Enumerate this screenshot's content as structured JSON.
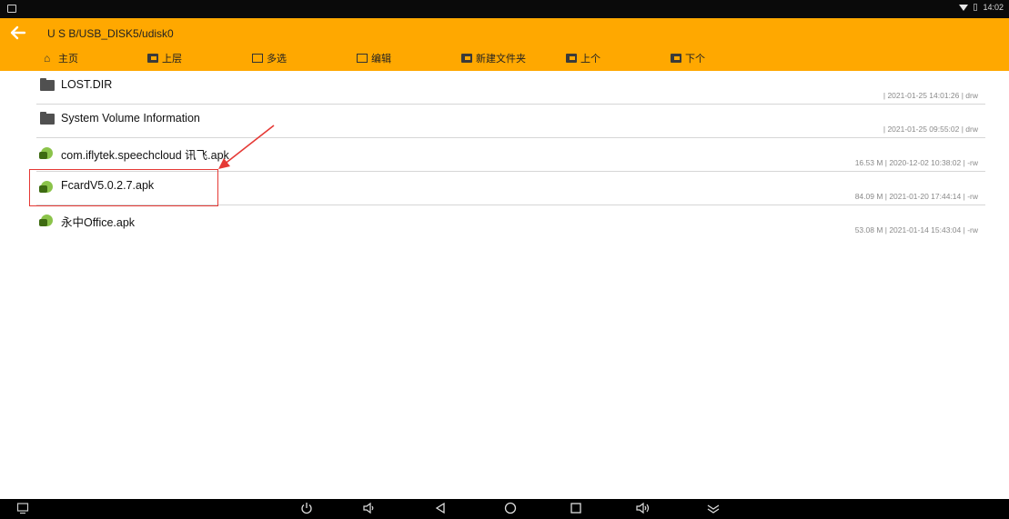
{
  "status_bar": {
    "time": "14:02"
  },
  "header": {
    "path": "U S B/USB_DISK5/udisk0",
    "background": "#ffa800"
  },
  "toolbar": {
    "home_label": "主页",
    "up_label": "上层",
    "multiselect_label": "多选",
    "edit_label": "编辑",
    "new_folder_label": "新建文件夹",
    "prev_label": "上个",
    "next_label": "下个"
  },
  "files": [
    {
      "name": "LOST.DIR",
      "type": "folder",
      "meta": "| 2021-01-25 14:01:26 | drw"
    },
    {
      "name": "System Volume Information",
      "type": "folder",
      "meta": "| 2021-01-25 09:55:02 | drw"
    },
    {
      "name": "com.iflytek.speechcloud 讯飞.apk",
      "type": "apk",
      "meta": "16.53 M | 2020-12-02 10:38:02 | -rw"
    },
    {
      "name": "FcardV5.0.2.7.apk",
      "type": "apk",
      "meta": "84.09 M | 2021-01-20 17:44:14 | -rw"
    },
    {
      "name": "永中Office.apk",
      "type": "apk",
      "meta": "53.08 M | 2021-01-14 15:43:04 | -rw"
    }
  ],
  "annotation": {
    "highlight_color": "#e53935"
  }
}
